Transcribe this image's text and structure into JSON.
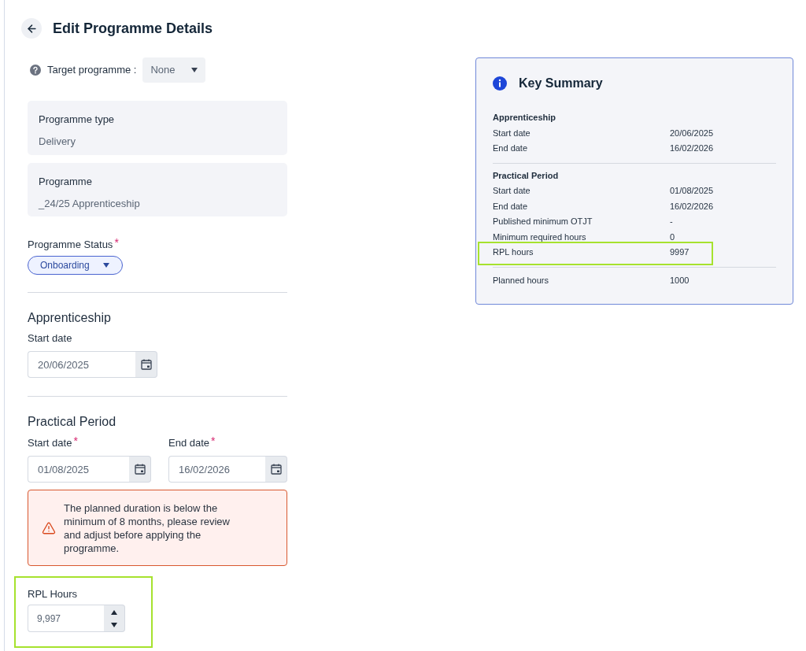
{
  "header": {
    "title": "Edit Programme Details"
  },
  "target_programme": {
    "label": "Target programme :",
    "value": "None"
  },
  "info_cards": [
    {
      "label": "Programme type",
      "value": "Delivery"
    },
    {
      "label": "Programme",
      "value": "_24/25 Apprenticeship"
    }
  ],
  "programme_status": {
    "label": "Programme Status",
    "required_mark": "*",
    "value": "Onboarding"
  },
  "apprenticeship": {
    "title": "Apprenticeship",
    "fields": [
      {
        "label": "Start date",
        "value": "20/06/2025"
      }
    ]
  },
  "practical_period": {
    "title": "Practical Period",
    "fields": [
      {
        "label": "Start date",
        "required_mark": "*",
        "value": "01/08/2025"
      },
      {
        "label": "End date",
        "required_mark": "*",
        "value": "16/02/2026"
      }
    ],
    "alert": {
      "message": "The planned duration is below the minimum of 8 months, please review and adjust before applying the programme."
    }
  },
  "rpl_hours": {
    "label": "RPL Hours",
    "value": "9,997",
    "highlighted": true
  },
  "key_summary": {
    "title": "Key Summary",
    "sections": [
      {
        "title": "Apprenticeship",
        "rows": [
          {
            "label": "Start date",
            "value": "20/06/2025",
            "highlighted": false
          },
          {
            "label": "End date",
            "value": "16/02/2026",
            "highlighted": false
          }
        ]
      },
      {
        "title": "Practical Period",
        "rows": [
          {
            "label": "Start date",
            "value": "01/08/2025",
            "highlighted": false
          },
          {
            "label": "End date",
            "value": "16/02/2026",
            "highlighted": false
          },
          {
            "label": "Published minimum OTJT",
            "value": "-",
            "highlighted": false
          },
          {
            "label": "Minimum required hours",
            "value": "0",
            "highlighted": false
          },
          {
            "label": "RPL hours",
            "value": "9997",
            "highlighted": true
          }
        ]
      },
      {
        "rows": [
          {
            "label": "Planned hours",
            "value": "1000",
            "highlighted": false
          }
        ]
      }
    ]
  }
}
